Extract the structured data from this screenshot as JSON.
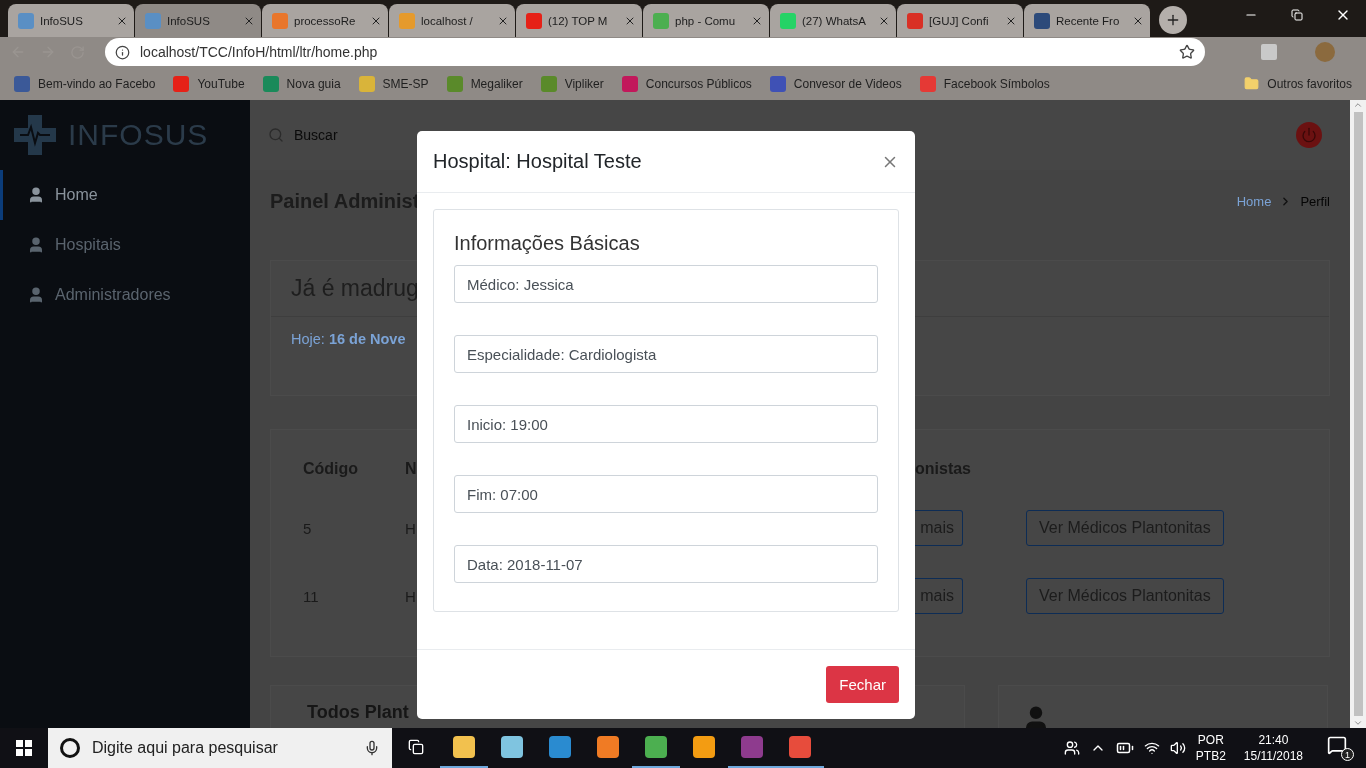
{
  "browser": {
    "tabs": [
      {
        "title": "InfoSUS",
        "selected": false,
        "color": "#5a8fc4"
      },
      {
        "title": "InfoSUS",
        "selected": true,
        "color": "#5a8fc4"
      },
      {
        "title": "processoRe",
        "selected": false,
        "color": "#e8762b"
      },
      {
        "title": "localhost /",
        "selected": false,
        "color": "#e59a2c"
      },
      {
        "title": "(12) TOP M",
        "selected": false,
        "color": "#e62117"
      },
      {
        "title": "php - Comu",
        "selected": false,
        "color": "#4caf50"
      },
      {
        "title": "(27) WhatsA",
        "selected": false,
        "color": "#25d366"
      },
      {
        "title": "[GUJ] Confi",
        "selected": false,
        "color": "#d93025"
      },
      {
        "title": "Recente Fro",
        "selected": false,
        "color": "#2c4a7a"
      }
    ],
    "address": "localhost/TCC/InfoH/html/ltr/home.php",
    "bookmarks": [
      {
        "label": "Bem-vindo ao Facebo",
        "color": "#3b5998"
      },
      {
        "label": "YouTube",
        "color": "#e62117"
      },
      {
        "label": "Nova guia",
        "color": "#1a8a5a"
      },
      {
        "label": "SME-SP",
        "color": "#d9b43a"
      },
      {
        "label": "Megaliker",
        "color": "#5a8a2a"
      },
      {
        "label": "Vipliker",
        "color": "#5a8a2a"
      },
      {
        "label": "Concursos Públicos",
        "color": "#c2185b"
      },
      {
        "label": "Convesor de Videos",
        "color": "#3f51b5"
      },
      {
        "label": "Facebook Símbolos",
        "color": "#e53935"
      }
    ],
    "other_bookmarks": "Outros favoritos"
  },
  "sidebar": {
    "logo": "INFOSUS",
    "items": [
      {
        "label": "Home",
        "selected": true
      },
      {
        "label": "Hospitais",
        "selected": false
      },
      {
        "label": "Administradores",
        "selected": false
      }
    ]
  },
  "topbar": {
    "search_placeholder": "Buscar"
  },
  "page": {
    "title": "Painel Administ",
    "breadcrumb": [
      {
        "label": "Home",
        "selected": false
      },
      {
        "label": "Perfil",
        "selected": true
      }
    ],
    "greeting": "Já é madrug",
    "today": "Hoje: **16 de Nove**",
    "table": {
      "columns": [
        "Código",
        "N",
        "onistas"
      ],
      "rows": [
        {
          "cells": [
            "5",
            "H"
          ],
          "buttons": [
            "mais",
            "Ver Médicos Plantonitas"
          ]
        },
        {
          "cells": [
            "11",
            "H"
          ],
          "buttons": [
            "mais",
            "Ver Médicos Plantonitas"
          ]
        }
      ]
    },
    "list_title": "Todos Plant"
  },
  "modal": {
    "title": "Hospital: Hospital Teste",
    "section_title": "Informações Básicas",
    "fields": [
      {
        "value": "Médico: Jessica"
      },
      {
        "value": "Especialidade: Cardiologista"
      },
      {
        "value": "Inicio: 19:00"
      },
      {
        "value": "Fim: 07:00"
      },
      {
        "value": "Data: 2018-11-07"
      }
    ],
    "close_button": "Fechar"
  },
  "taskbar": {
    "search_placeholder": "Digite aqui para pesquisar",
    "apps": [
      {
        "color": "#f2c14e",
        "open": true
      },
      {
        "color": "#7fc4e0",
        "open": false
      },
      {
        "color": "#2a8bd0",
        "open": false
      },
      {
        "color": "#f07b24",
        "open": false
      },
      {
        "color": "#4caf50",
        "open": true
      },
      {
        "color": "#f39c12",
        "open": false
      },
      {
        "color": "#8e3b8e",
        "open": true
      },
      {
        "color": "#e74c3c",
        "open": true
      }
    ],
    "language": "POR",
    "layout": "PTB2",
    "time": "21:40",
    "date": "15/11/2018",
    "notifications": "1"
  }
}
